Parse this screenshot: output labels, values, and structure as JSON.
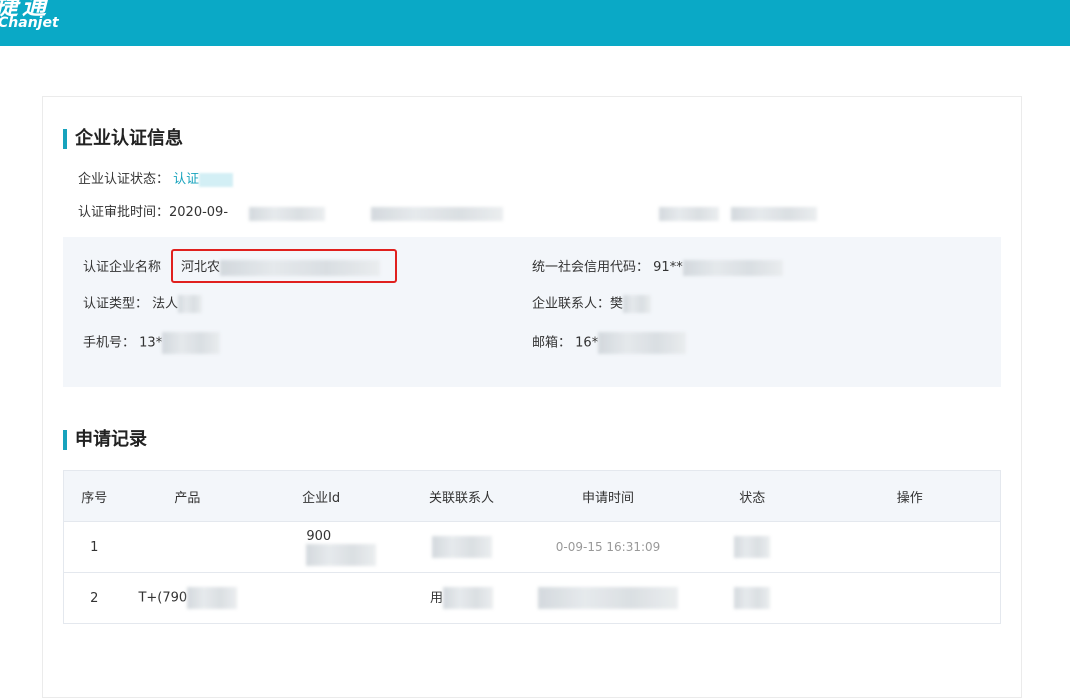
{
  "header": {
    "logo_cn": "捷通",
    "logo_en": "Chanjet",
    "brand_color": "#0aa9c6"
  },
  "cert": {
    "section_title": "企业认证信息",
    "status_label": "企业认证状态：",
    "status_value": "认证",
    "time_label": "认证审批时间：",
    "time_value": "2020-09-",
    "company_name_label": "认证企业名称",
    "company_name_value": "河北农",
    "credit_code_label": "统一社会信用代码：",
    "credit_code_value": "91**",
    "type_label": "认证类型：",
    "type_value": "法人",
    "contact_label": "企业联系人：",
    "contact_value": "樊",
    "phone_label": "手机号：",
    "phone_value": "13*",
    "email_label": "邮箱：",
    "email_value": "16*"
  },
  "records": {
    "section_title": "申请记录",
    "columns": [
      "序号",
      "产品",
      "企业Id",
      "关联联系人",
      "申请时间",
      "状态",
      "操作"
    ],
    "rows": [
      {
        "index": "1",
        "product": "",
        "company_id": "900",
        "contact": "",
        "time": "0-09-15 16:31:09",
        "status": "",
        "action": ""
      },
      {
        "index": "2",
        "product": "T+(790",
        "company_id": "",
        "contact": "用",
        "time": "",
        "status": "",
        "action": ""
      }
    ]
  },
  "accent_color": "#17a3bd",
  "highlight_color": "#e0201e"
}
